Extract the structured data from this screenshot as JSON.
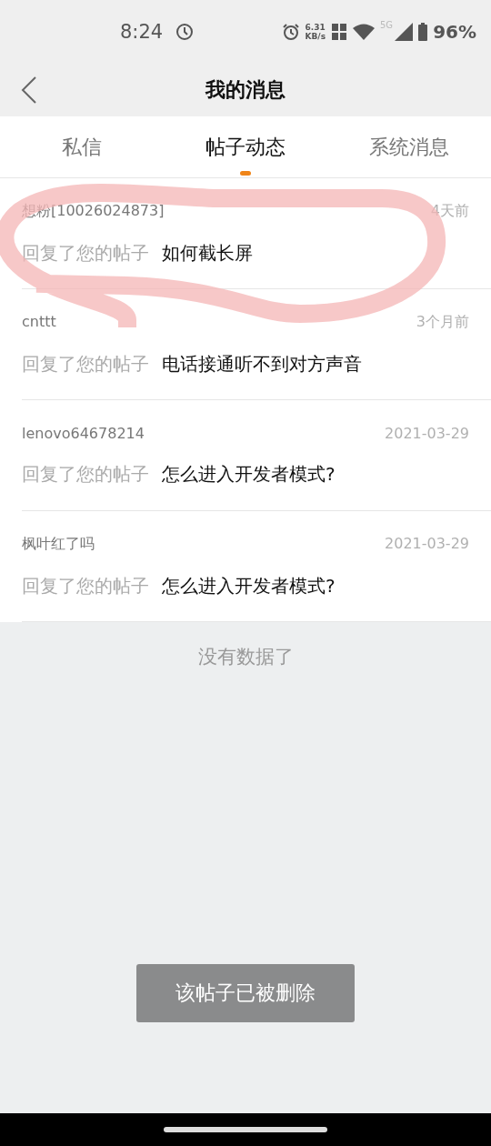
{
  "status_bar": {
    "time": "8:24",
    "net_speed": "6.31",
    "net_unit": "KB/s",
    "network": "5G",
    "battery": "96%"
  },
  "header": {
    "title": "我的消息"
  },
  "tabs": [
    {
      "label": "私信",
      "selected": false
    },
    {
      "label": "帖子动态",
      "selected": true
    },
    {
      "label": "系统消息",
      "selected": false
    }
  ],
  "messages": [
    {
      "user": "想粉[10026024873]",
      "time": "4天前",
      "action": "回复了您的帖子",
      "post": "如何截长屏"
    },
    {
      "user": "cnttt",
      "time": "3个月前",
      "action": "回复了您的帖子",
      "post": "电话接通听不到对方声音"
    },
    {
      "user": "lenovo64678214",
      "time": "2021-03-29",
      "action": "回复了您的帖子",
      "post": "怎么进入开发者模式?"
    },
    {
      "user": "枫叶红了吗",
      "time": "2021-03-29",
      "action": "回复了您的帖子",
      "post": "怎么进入开发者模式?"
    }
  ],
  "end_note": "没有数据了",
  "toast": "该帖子已被删除"
}
